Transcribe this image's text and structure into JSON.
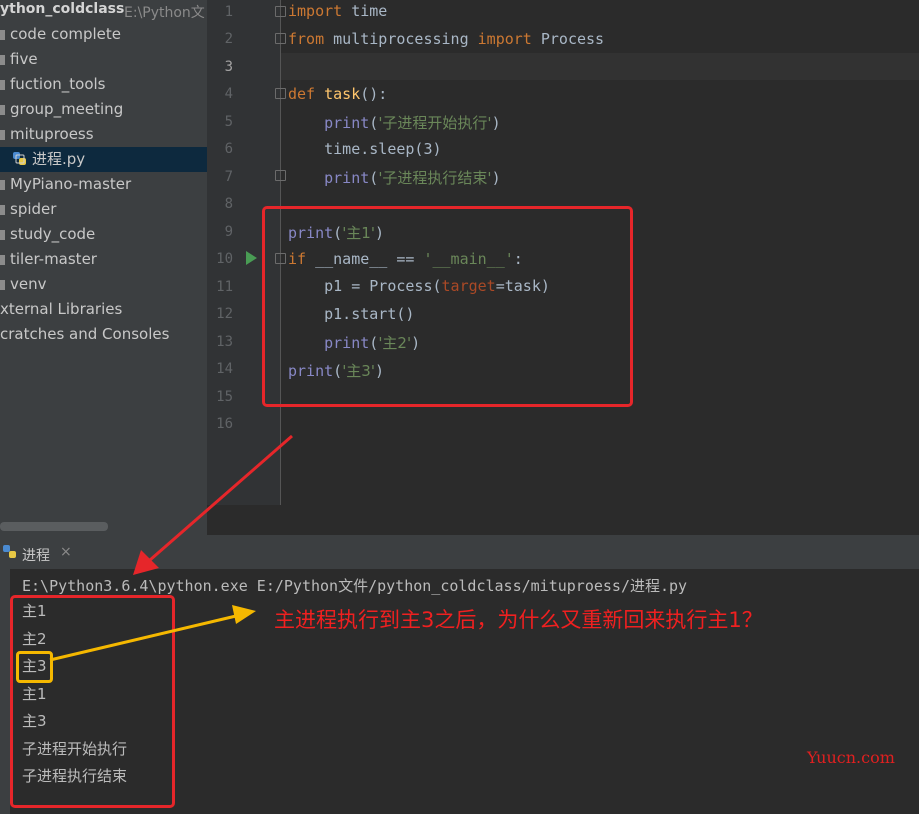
{
  "project": {
    "name": "ython_coldclass",
    "path": "E:\\Python文"
  },
  "tree": [
    {
      "label": "code complete"
    },
    {
      "label": "five"
    },
    {
      "label": "fuction_tools"
    },
    {
      "label": "group_meeting"
    },
    {
      "label": "mituproess"
    },
    {
      "label": "进程.py",
      "selected": true,
      "icon": "python-file-icon"
    },
    {
      "label": "MyPiano-master"
    },
    {
      "label": "spider"
    },
    {
      "label": "study_code"
    },
    {
      "label": "tiler-master"
    },
    {
      "label": "venv"
    },
    {
      "label": "xternal Libraries"
    },
    {
      "label": "cratches and Consoles"
    }
  ],
  "editor": {
    "line_numbers": [
      "1",
      "2",
      "3",
      "4",
      "5",
      "6",
      "7",
      "8",
      "9",
      "10",
      "11",
      "12",
      "13",
      "14",
      "15",
      "16"
    ],
    "current_line": "3",
    "code": {
      "l1_kw": "import",
      "l1_rest": " time",
      "l2_kw1": "from",
      "l2_mid": " multiprocessing ",
      "l2_kw2": "import",
      "l2_rest": " Process",
      "l4_kw": "def",
      "l4_fn": "task",
      "l4_rest": "():",
      "l5_bi": "print",
      "l5_open": "(",
      "l5_str": "'子进程开始执行'",
      "l5_close": ")",
      "l6": "time.sleep(3)",
      "l7_bi": "print",
      "l7_open": "(",
      "l7_str": "'子进程执行结束'",
      "l7_close": ")",
      "l9_bi": "print",
      "l9_open": "(",
      "l9_str": "'主1'",
      "l9_close": ")",
      "l10_kw": "if",
      "l10_mid": " __name__ == ",
      "l10_str": "'__main__'",
      "l10_rest": ":",
      "l11_a": "p1 = Process(",
      "l11_pm": "target",
      "l11_b": "=task)",
      "l12": "p1.start()",
      "l13_bi": "print",
      "l13_open": "(",
      "l13_str": "'主2'",
      "l13_close": ")",
      "l14_bi": "print",
      "l14_open": "(",
      "l14_str": "'主3'",
      "l14_close": ")"
    }
  },
  "run_panel": {
    "tab_label": "进程",
    "close_glyph": "×",
    "command": "E:\\Python3.6.4\\python.exe E:/Python文件/python_coldclass/mituproess/进程.py",
    "output": [
      "主1",
      "主2",
      "主3",
      "主1",
      "主3",
      "子进程开始执行",
      "子进程执行结束"
    ]
  },
  "annotation": {
    "text": "主进程执行到主3之后，为什么又重新回来执行主1？"
  },
  "watermark": "Yuucn.com",
  "colors": {
    "red_annotation": "#e6262a",
    "yellow_highlight": "#f5b800",
    "keyword": "#cc7832",
    "string": "#6a8759",
    "builtin": "#8888c6"
  }
}
